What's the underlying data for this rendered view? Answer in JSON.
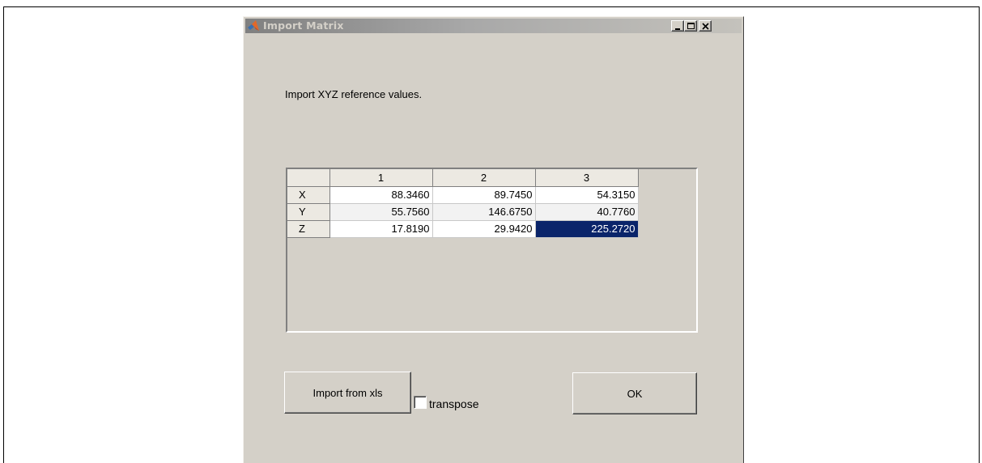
{
  "window": {
    "title": "Import Matrix",
    "icon": "matlab-icon",
    "controls": {
      "minimize": "minimize-icon",
      "maximize": "maximize-icon",
      "close": "close-icon"
    }
  },
  "prompt": "Import XYZ reference values.",
  "table": {
    "columns": [
      "1",
      "2",
      "3"
    ],
    "rows": [
      {
        "label": "X",
        "values": [
          "88.3460",
          "89.7450",
          "54.3150"
        ]
      },
      {
        "label": "Y",
        "values": [
          "55.7560",
          "146.6750",
          "40.7760"
        ]
      },
      {
        "label": "Z",
        "values": [
          "17.8190",
          "29.9420",
          "225.2720"
        ]
      }
    ],
    "selected_cell": {
      "row": "Z",
      "column": "3"
    }
  },
  "buttons": {
    "import_label": "Import from xls",
    "ok_label": "OK"
  },
  "transpose": {
    "label": "transpose",
    "checked": false
  },
  "colors": {
    "dialog_background": "#d4d0c8",
    "selection": "#0a246a",
    "title_gradient_start": "#808080"
  }
}
